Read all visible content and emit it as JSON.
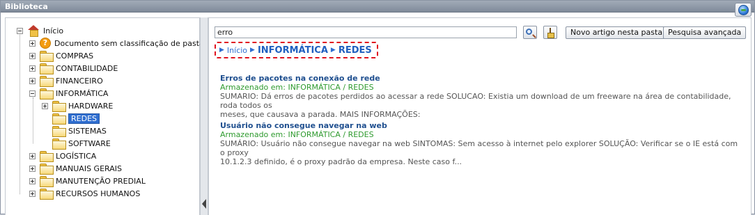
{
  "window": {
    "title": "Biblioteca"
  },
  "tree": {
    "root": {
      "label": "Início"
    },
    "unclassified": {
      "label": "Documento sem classificação de pasta"
    },
    "items": [
      {
        "label": "COMPRAS"
      },
      {
        "label": "CONTABILIDADE"
      },
      {
        "label": "FINANCEIRO"
      },
      {
        "label": "INFORMÁTICA"
      },
      {
        "label": "LOGÍSTICA"
      },
      {
        "label": "MANUAIS GERAIS"
      },
      {
        "label": "MANUTENÇÃO PREDIAL"
      },
      {
        "label": "RECURSOS HUMANOS"
      }
    ],
    "informatica_children": [
      {
        "label": "HARDWARE"
      },
      {
        "label": "REDES"
      },
      {
        "label": "SISTEMAS"
      },
      {
        "label": "SOFTWARE"
      }
    ]
  },
  "toolbar": {
    "search_value": "erro",
    "new_article_label": "Novo artigo nesta pasta",
    "advanced_search_label": "Pesquisa avançada"
  },
  "breadcrumb": {
    "home": "Início",
    "level1": "INFORMÁTICA",
    "level2": "REDES"
  },
  "results": [
    {
      "title": "Erros de pacotes na conexão de rede",
      "path": "Armazenado em: INFORMÁTICA / REDES",
      "summary_line1": "SUMARIO: Dá erros de pacotes perdidos ao acessar a rede SOLUCAO: Existia um download de um freeware na área de contabilidade, roda todos os",
      "summary_line2": "meses, que causava a parada. MAIS INFORMAÇÕES:"
    },
    {
      "title": "Usuário não consegue navegar na web",
      "path": "Armazenado em: INFORMÁTICA / REDES",
      "summary_line1": "SUMÁRIO: Usuário não consegue navegar na web SINTOMAS: Sem acesso à internet pelo explorer SOLUÇÃO: Verificar se o IE está com o proxy",
      "summary_line2": "10.1.2.3 definido, é o proxy padrão da empresa. Neste caso f..."
    }
  ],
  "icons": {
    "help": "help-globe-icon",
    "search": "magnifier-icon",
    "clear": "broom-icon",
    "folder": "folder-icon",
    "home": "home-icon",
    "warning": "warning-icon"
  },
  "colors": {
    "selection": "#2f6ed0",
    "breadcrumb_border": "#e0131f",
    "result_title": "#1f4f8f",
    "result_path": "#2e9a2e"
  }
}
